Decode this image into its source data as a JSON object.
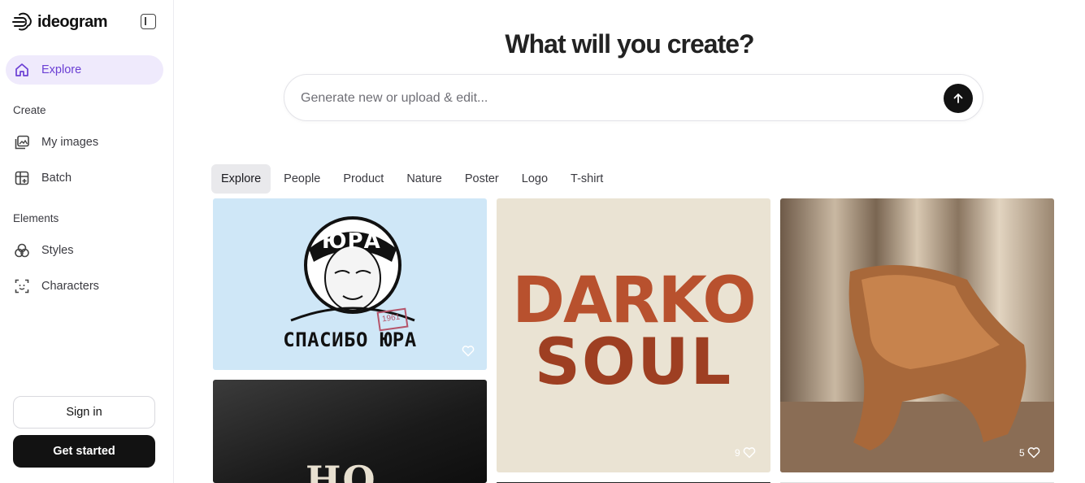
{
  "brand": {
    "name": "ideogram"
  },
  "sidebar": {
    "explore_label": "Explore",
    "create_section": "Create",
    "create_items": [
      {
        "label": "My images",
        "icon": "images-icon"
      },
      {
        "label": "Batch",
        "icon": "batch-icon"
      }
    ],
    "elements_section": "Elements",
    "element_items": [
      {
        "label": "Styles",
        "icon": "styles-icon"
      },
      {
        "label": "Characters",
        "icon": "characters-icon"
      }
    ],
    "signin_label": "Sign in",
    "getstarted_label": "Get started"
  },
  "main": {
    "headline": "What will you create?",
    "prompt_placeholder": "Generate new or upload & edit...",
    "tabs": [
      "Explore",
      "People",
      "Product",
      "Nature",
      "Poster",
      "Logo",
      "T-shirt"
    ],
    "active_tab": "Explore"
  },
  "gallery": [
    {
      "title_top": "ЮРА",
      "caption": "СПАСИБО ЮРА",
      "stamp": "1961",
      "likes": ""
    },
    {
      "line1": "DARKO",
      "line2": "SOUL",
      "likes": "9"
    },
    {
      "subject": "wooden chair",
      "likes": "5"
    },
    {
      "partial_text": "HO"
    }
  ],
  "colors": {
    "accent": "#6b3fd4",
    "active_nav_bg": "#efeafc",
    "primary_button": "#121212"
  }
}
